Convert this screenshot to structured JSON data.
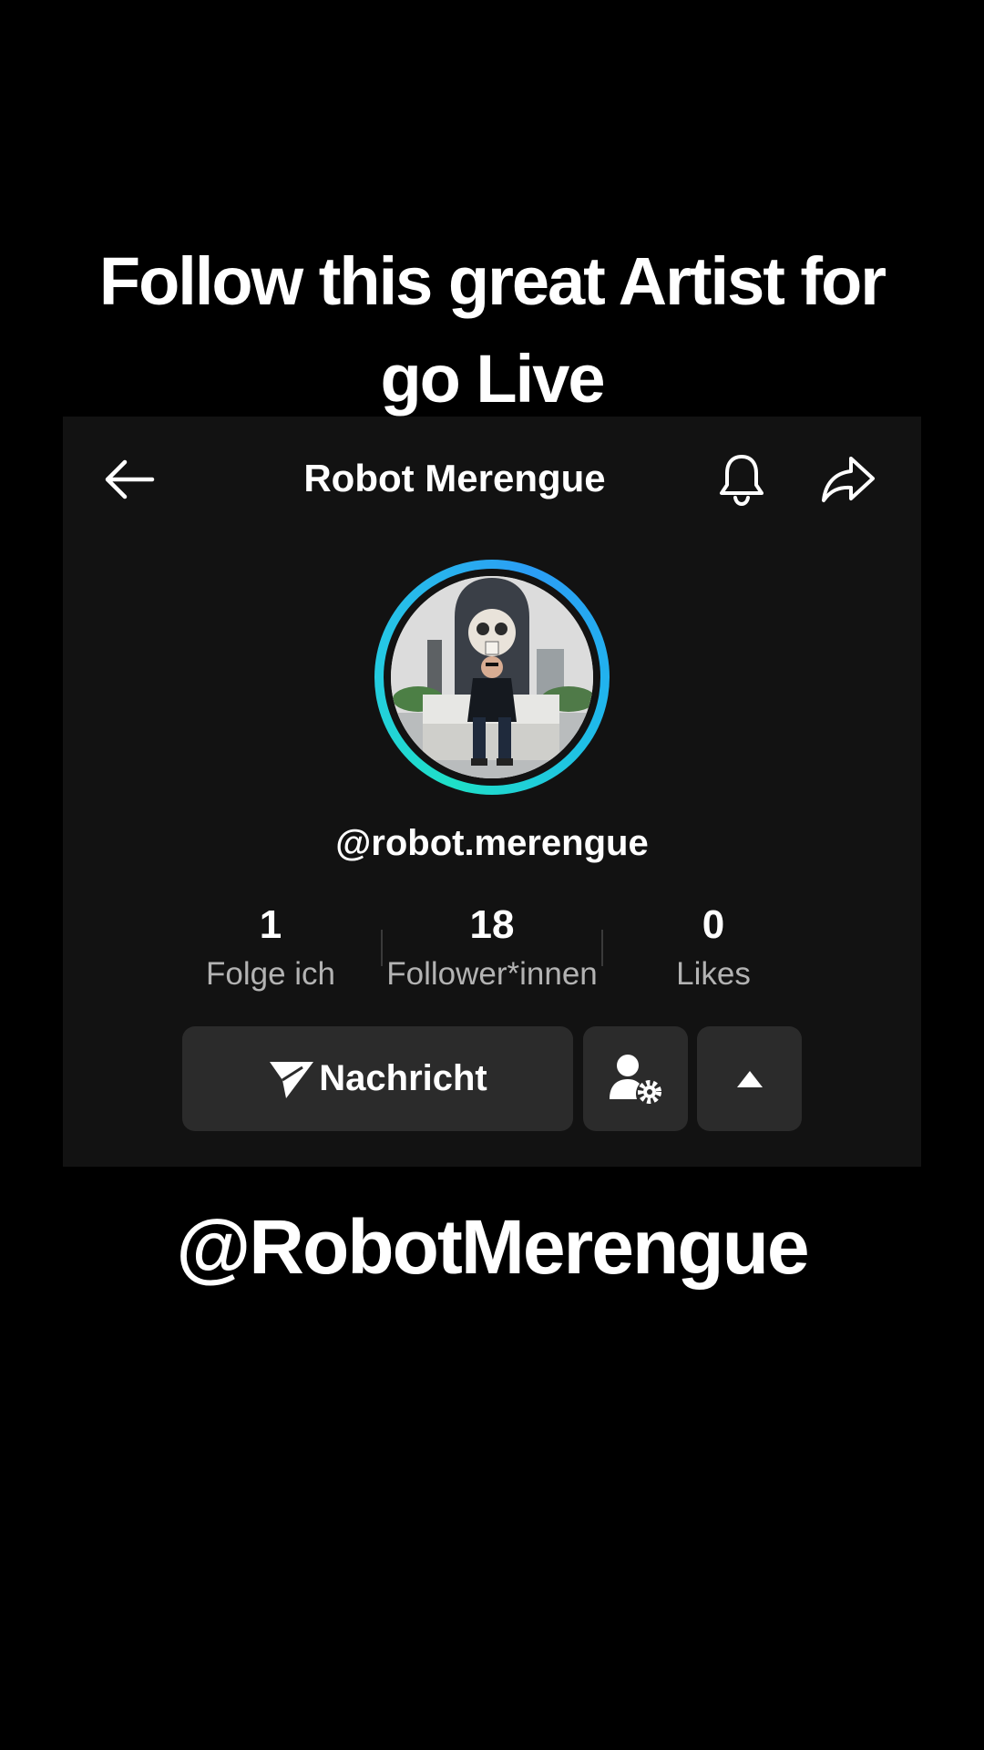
{
  "headline": {
    "line1": "Follow this great Artist for",
    "line2": "go Live"
  },
  "profile": {
    "title": "Robot Merengue",
    "handle": "@robot.merengue",
    "stats": [
      {
        "value": "1",
        "label": "Folge ich"
      },
      {
        "value": "18",
        "label": "Follower*innen"
      },
      {
        "value": "0",
        "label": "Likes"
      }
    ],
    "message_button_label": "Nachricht"
  },
  "icons": {
    "back": "back-arrow-icon",
    "bell": "bell-icon",
    "share": "share-icon",
    "message": "send-icon",
    "user_settings": "user-settings-icon",
    "more": "triangle-up-icon"
  },
  "colors": {
    "background": "#000000",
    "card": "#121212",
    "button": "#2b2b2b",
    "ring_start": "#2b9df5",
    "ring_end": "#1fe0c8"
  },
  "footer": {
    "handle": "@RobotMerengue"
  }
}
